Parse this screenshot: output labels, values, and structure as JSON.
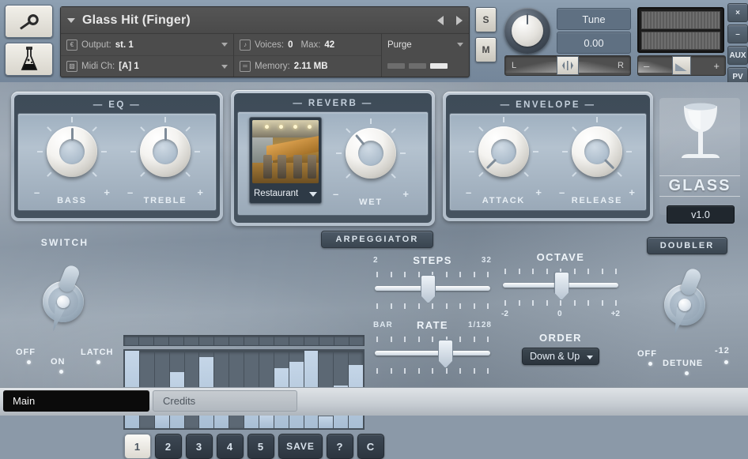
{
  "header": {
    "wrench_icon": "wrench-icon",
    "flask_icon": "flask-icon",
    "instrument_name": "Glass Hit (Finger)",
    "output_label": "Output:",
    "output_value": "st. 1",
    "midi_label": "Midi Ch:",
    "midi_value": "[A] 1",
    "voices_label": "Voices:",
    "voices_value": "0",
    "max_label": "Max:",
    "max_value": "42",
    "memory_label": "Memory:",
    "memory_value": "2.11 MB",
    "purge_label": "Purge",
    "solo_label": "S",
    "mute_label": "M",
    "tune_label": "Tune",
    "tune_value": "0.00",
    "pan_left": "L",
    "pan_right": "R",
    "vol_minus": "–",
    "vol_plus": "+",
    "edge_buttons": [
      "×",
      "–",
      "AUX",
      "PV"
    ]
  },
  "eq": {
    "title": "— EQ —",
    "knobs": [
      {
        "name": "BASS",
        "minus": "–",
        "plus": "+",
        "angle": 0
      },
      {
        "name": "TREBLE",
        "minus": "–",
        "plus": "+",
        "angle": 0
      }
    ]
  },
  "reverb": {
    "title": "— REVERB —",
    "ir_name": "Restaurant",
    "wet": {
      "name": "WET",
      "minus": "–",
      "plus": "+",
      "angle": -40
    }
  },
  "envelope": {
    "title": "— ENVELOPE —",
    "knobs": [
      {
        "name": "ATTACK",
        "minus": "–",
        "plus": "+",
        "angle": -135
      },
      {
        "name": "RELEASE",
        "minus": "–",
        "plus": "+",
        "angle": 135
      }
    ]
  },
  "logo": {
    "word": "GLASS",
    "version": "v1.0",
    "glass_icon": "wine-glass-icon"
  },
  "arpeggiator": {
    "badge": "ARPEGGIATOR",
    "presets": [
      "1",
      "2",
      "3",
      "4",
      "5",
      "SAVE",
      "?",
      "C"
    ],
    "active_preset": "1",
    "steps": {
      "title": "STEPS",
      "min": "2",
      "max": "32",
      "handle_pct": 45
    },
    "rate": {
      "title": "RATE",
      "min": "BAR",
      "max": "1/128",
      "handle_pct": 62
    },
    "octave": {
      "title": "OCTAVE",
      "min": "-2",
      "mid": "0",
      "max": "+2",
      "handle_pct": 50
    },
    "order": {
      "title": "ORDER",
      "value": "Down & Up"
    }
  },
  "sequencer": {
    "step_count": 16,
    "values": [
      100,
      0,
      25,
      72,
      0,
      92,
      50,
      0,
      50,
      18,
      78,
      86,
      100,
      15,
      55,
      82
    ]
  },
  "switch": {
    "title": "SWITCH",
    "off_label": "OFF",
    "on_label": "ON",
    "latch_label": "LATCH"
  },
  "doubler": {
    "title": "DOUBLER",
    "off_label": "OFF",
    "detune_label": "DETUNE",
    "semitone_label": "-12"
  },
  "tabs": [
    {
      "label": "Main",
      "active": true
    },
    {
      "label": "Credits",
      "active": false
    }
  ],
  "colors": {
    "panel_dark": "#3e4b58",
    "panel_light": "#9fb0c0",
    "accent": "#c5d6e8",
    "body_bg": "#8794a2"
  }
}
